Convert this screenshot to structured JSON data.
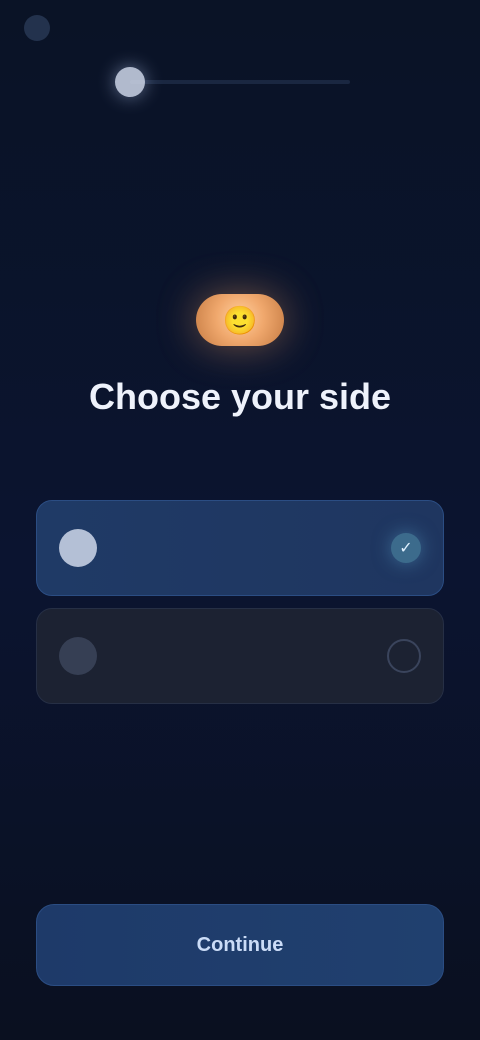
{
  "topbar": {
    "back_label": "",
    "right_label": ""
  },
  "progress": {
    "value_fraction": 0.0
  },
  "hero": {
    "badge_text": "🙂"
  },
  "heading": {
    "title": "Choose your side",
    "subtitle": ""
  },
  "options": [
    {
      "label": "",
      "icon": "circle-icon",
      "selected": true,
      "radio_mark": "✓"
    },
    {
      "label": "",
      "icon": "circle-icon",
      "selected": false,
      "radio_mark": ""
    }
  ],
  "cta": {
    "label": "Continue"
  },
  "colors": {
    "background": "#0b1430",
    "accent": "#1f3a66",
    "badge": "#f0a86d"
  }
}
